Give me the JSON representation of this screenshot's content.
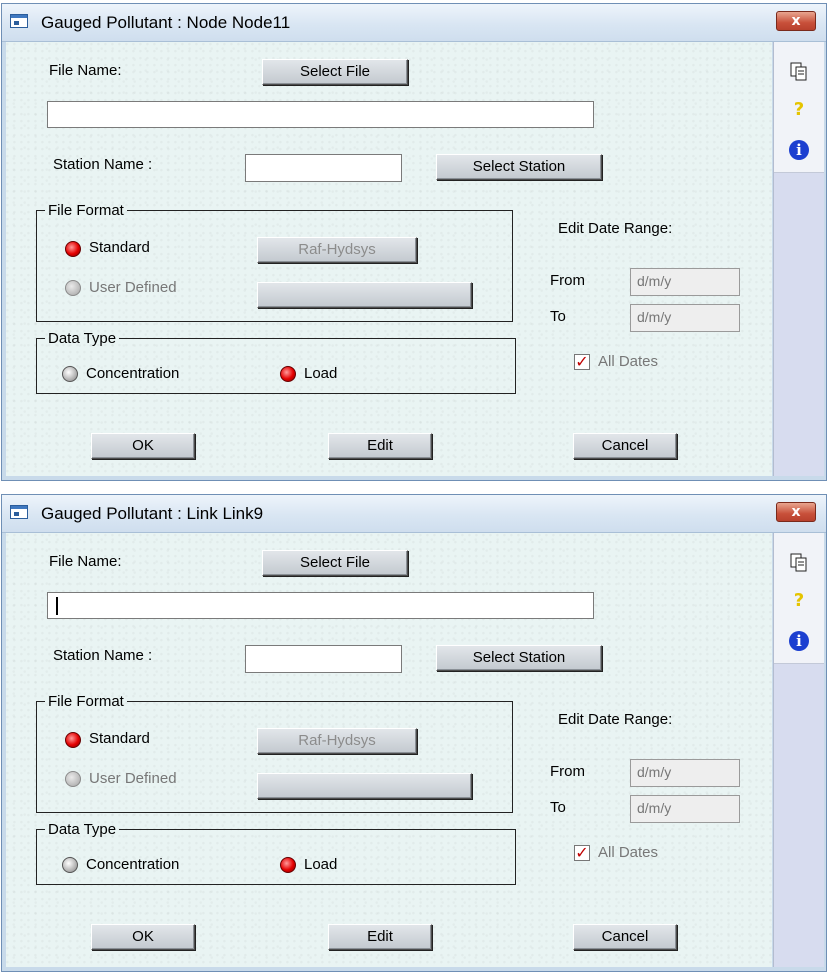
{
  "windows": [
    {
      "title": "Gauged Pollutant : Node Node11",
      "close_glyph": "x",
      "file_name_label": "File Name:",
      "select_file_label": "Select File",
      "file_path_value": "",
      "station_name_label": "Station Name :",
      "station_name_value": "",
      "select_station_label": "Select Station",
      "file_format_legend": "File Format",
      "standard_label": "Standard",
      "standard_selected": true,
      "standard_format_button": "Raf-Hydsys",
      "user_defined_label": "User Defined",
      "user_defined_selected": false,
      "user_defined_format_button": "",
      "data_type_legend": "Data Type",
      "concentration_label": "Concentration",
      "concentration_selected": false,
      "load_label": "Load",
      "load_selected": true,
      "edit_date_range_label": "Edit Date Range:",
      "from_label": "From",
      "from_placeholder": "d/m/y",
      "to_label": "To",
      "to_placeholder": "d/m/y",
      "all_dates_label": "All Dates",
      "all_dates_checked": true,
      "ok_label": "OK",
      "edit_label": "Edit",
      "cancel_label": "Cancel",
      "side_icons": [
        "copy-icon",
        "help-icon",
        "info-icon"
      ]
    },
    {
      "title": "Gauged Pollutant : Link Link9",
      "close_glyph": "x",
      "file_name_label": "File Name:",
      "select_file_label": "Select File",
      "file_path_value": "",
      "station_name_label": "Station Name :",
      "station_name_value": "",
      "select_station_label": "Select Station",
      "file_format_legend": "File Format",
      "standard_label": "Standard",
      "standard_selected": true,
      "standard_format_button": "Raf-Hydsys",
      "user_defined_label": "User Defined",
      "user_defined_selected": false,
      "user_defined_format_button": "",
      "data_type_legend": "Data Type",
      "concentration_label": "Concentration",
      "concentration_selected": false,
      "load_label": "Load",
      "load_selected": true,
      "edit_date_range_label": "Edit Date Range:",
      "from_label": "From",
      "from_placeholder": "d/m/y",
      "to_label": "To",
      "to_placeholder": "d/m/y",
      "all_dates_label": "All Dates",
      "all_dates_checked": true,
      "ok_label": "OK",
      "edit_label": "Edit",
      "cancel_label": "Cancel",
      "side_icons": [
        "copy-icon",
        "help-icon",
        "info-icon"
      ]
    }
  ],
  "colors": {
    "title_bar": "#dbe7f4",
    "close_button": "#c8503a",
    "dialog_background": "#e9f4f3",
    "side_panel": "#d7dcef",
    "radio_selected": "#e40000",
    "checkbox_mark": "#c00000"
  }
}
